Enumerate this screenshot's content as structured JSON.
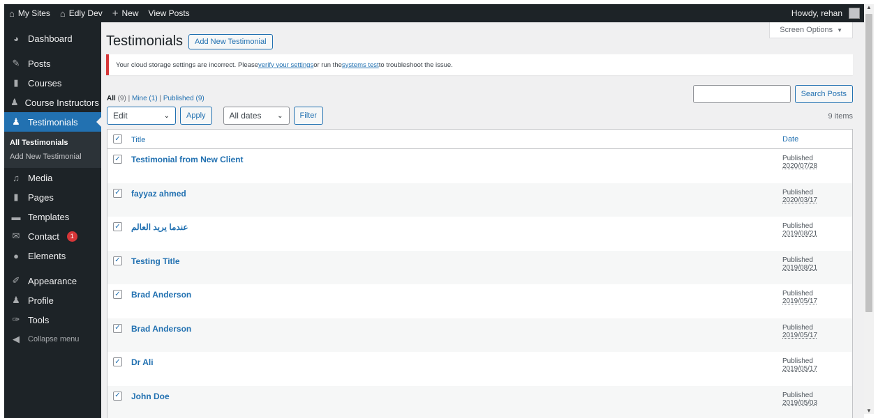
{
  "adminbar": {
    "my_sites": "My Sites",
    "site_name": "Edly Dev",
    "new": "New",
    "view_posts": "View Posts",
    "howdy": "Howdy, rehan"
  },
  "sidebar": {
    "items": [
      {
        "label": "Dashboard"
      },
      {
        "label": "Posts"
      },
      {
        "label": "Courses"
      },
      {
        "label": "Course Instructors"
      },
      {
        "label": "Testimonials"
      },
      {
        "label": "Media"
      },
      {
        "label": "Pages"
      },
      {
        "label": "Templates"
      },
      {
        "label": "Contact",
        "badge": "1"
      },
      {
        "label": "Elements"
      },
      {
        "label": "Appearance"
      },
      {
        "label": "Profile"
      },
      {
        "label": "Tools"
      },
      {
        "label": "Collapse menu"
      }
    ],
    "submenu": [
      "All Testimonials",
      "Add New Testimonial"
    ]
  },
  "main": {
    "screen_options": "Screen Options",
    "title": "Testimonials",
    "add_new": "Add New Testimonial",
    "notice": {
      "part1": "Your cloud storage settings are incorrect. Please ",
      "link1": "verify your settings",
      "part2": " or run the ",
      "link2": "systems test",
      "part3": " to troubleshoot the issue."
    },
    "filters": {
      "all": "All",
      "all_count": "(9)",
      "mine": "Mine",
      "mine_count": "(1)",
      "published": "Published",
      "published_count": "(9)"
    },
    "search_button": "Search Posts",
    "bulk_action": "Edit",
    "apply": "Apply",
    "dates": "All dates",
    "filter": "Filter",
    "items_count": "9 items",
    "table": {
      "col_title": "Title",
      "col_date": "Date",
      "rows": [
        {
          "title": "Testimonial from New Client",
          "status": "Published",
          "date": "2020/07/28"
        },
        {
          "title": "fayyaz ahmed",
          "status": "Published",
          "date": "2020/03/17"
        },
        {
          "title": "عندما يريد العالم",
          "status": "Published",
          "date": "2019/08/21"
        },
        {
          "title": "Testing Title",
          "status": "Published",
          "date": "2019/08/21"
        },
        {
          "title": "Brad Anderson",
          "status": "Published",
          "date": "2019/05/17"
        },
        {
          "title": "Brad Anderson",
          "status": "Published",
          "date": "2019/05/17"
        },
        {
          "title": "Dr Ali",
          "status": "Published",
          "date": "2019/05/17"
        },
        {
          "title": "John Doe",
          "status": "Published",
          "date": "2019/05/03"
        }
      ]
    }
  },
  "colors": {
    "admin_dark": "#1d2327",
    "accent": "#2271b1",
    "notice_error": "#d63638"
  }
}
